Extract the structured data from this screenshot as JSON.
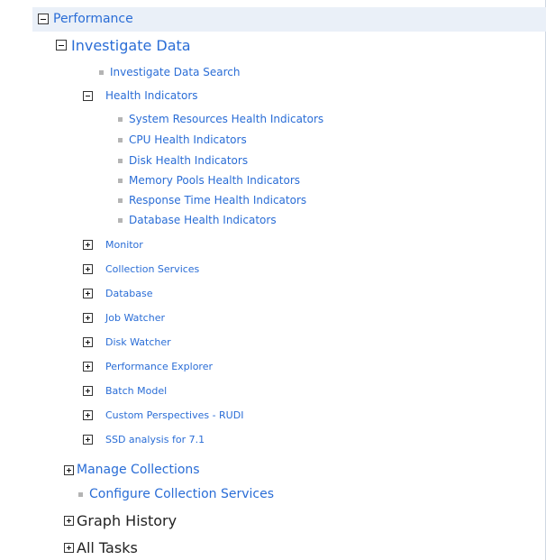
{
  "tree": {
    "root": {
      "label": "Performance"
    },
    "investigate_data": {
      "label": "Investigate Data"
    },
    "investigate_data_search": {
      "label": "Investigate Data Search"
    },
    "health_indicators": {
      "label": "Health Indicators"
    },
    "health_children": [
      {
        "label": "System Resources Health Indicators"
      },
      {
        "label": "CPU Health Indicators"
      },
      {
        "label": "Disk Health Indicators"
      },
      {
        "label": "Memory Pools Health Indicators"
      },
      {
        "label": "Response Time Health Indicators"
      },
      {
        "label": "Database Health Indicators"
      }
    ],
    "sub_groups": [
      {
        "label": "Monitor"
      },
      {
        "label": "Collection Services"
      },
      {
        "label": "Database"
      },
      {
        "label": "Job Watcher"
      },
      {
        "label": "Disk Watcher"
      },
      {
        "label": "Performance Explorer"
      },
      {
        "label": "Batch Model"
      },
      {
        "label": "Custom Perspectives - RUDI"
      },
      {
        "label": "SSD analysis for 7.1"
      }
    ],
    "manage_collections": {
      "label": "Manage Collections"
    },
    "configure_collection_services": {
      "label": "Configure Collection Services"
    },
    "graph_history": {
      "label": "Graph History"
    },
    "all_tasks": {
      "label": "All Tasks"
    }
  },
  "colors": {
    "link": "#2a6dd6",
    "header_bg": "#eaf0f8",
    "bullet": "#b4b4b4",
    "dark_text": "#222222"
  },
  "icons": {
    "expanded": "minus-box-icon",
    "collapsed": "plus-box-icon",
    "leaf": "square-bullet-icon"
  }
}
